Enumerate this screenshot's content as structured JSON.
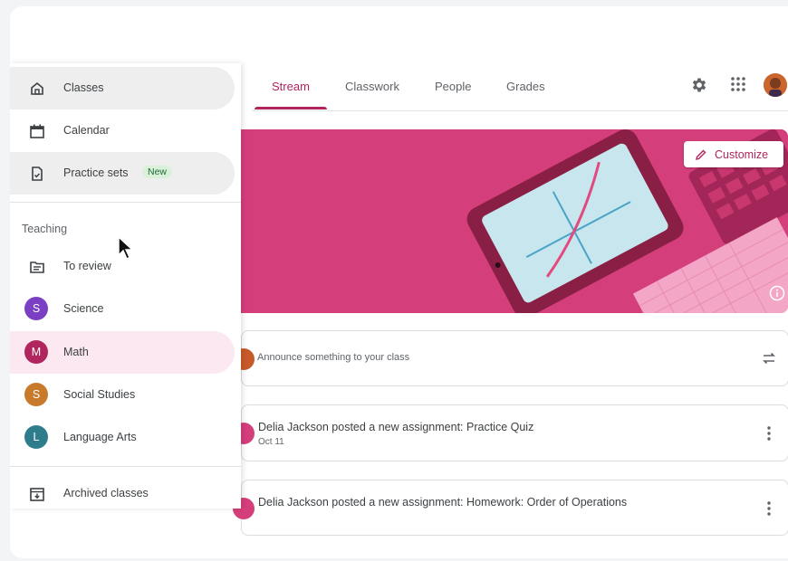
{
  "tabs": [
    {
      "label": "Stream",
      "active": true
    },
    {
      "label": "Classwork",
      "active": false
    },
    {
      "label": "People",
      "active": false
    },
    {
      "label": "Grades",
      "active": false
    }
  ],
  "header_icons": [
    "gear-icon",
    "apps-grid-icon",
    "user-avatar"
  ],
  "banner": {
    "color": "#d43e7b",
    "customize_label": "Customize",
    "icons": [
      "pencil-icon",
      "info-icon"
    ]
  },
  "announce": {
    "placeholder": "Announce something to your class",
    "icon": "repost-icon"
  },
  "posts": [
    {
      "title": "Delia Jackson posted a new assignment: Practice Quiz",
      "date": "Oct 11"
    },
    {
      "title": "Delia Jackson posted a new assignment: Homework: Order of Operations",
      "date": ""
    }
  ],
  "drawer": {
    "top_items": [
      {
        "label": "Classes",
        "icon": "home-icon"
      },
      {
        "label": "Calendar",
        "icon": "calendar-icon"
      },
      {
        "label": "Practice sets",
        "icon": "practice-sets-icon",
        "badge": "New"
      }
    ],
    "section_label": "Teaching",
    "review": {
      "label": "To review",
      "icon": "folder-icon"
    },
    "classes": [
      {
        "letter": "S",
        "label": "Science",
        "color": "#7b3fc4"
      },
      {
        "letter": "M",
        "label": "Math",
        "color": "#b0255e",
        "selected": true
      },
      {
        "letter": "S",
        "label": "Social Studies",
        "color": "#c87a2a"
      },
      {
        "letter": "L",
        "label": "Language Arts",
        "color": "#2f7d8c"
      }
    ],
    "archived": {
      "label": "Archived classes",
      "icon": "archive-icon"
    }
  },
  "accent": "#b0255e"
}
